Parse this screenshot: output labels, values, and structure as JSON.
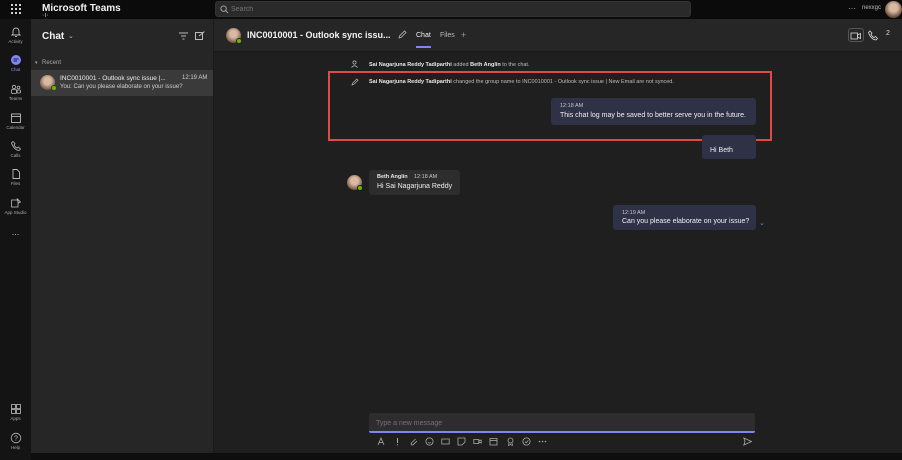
{
  "topbar": {
    "app_title": "Microsoft Teams",
    "search_placeholder": "Search",
    "org_label": "nexxgc"
  },
  "rail": {
    "items": [
      {
        "label": "Activity",
        "icon": "bell-icon"
      },
      {
        "label": "Chat",
        "icon": "chat-icon"
      },
      {
        "label": "Teams",
        "icon": "teams-icon"
      },
      {
        "label": "Calendar",
        "icon": "calendar-icon"
      },
      {
        "label": "Calls",
        "icon": "phone-icon"
      },
      {
        "label": "Files",
        "icon": "file-icon"
      },
      {
        "label": "App Studio",
        "icon": "app-studio-icon"
      },
      {
        "label": "...",
        "icon": "more-icon"
      },
      {
        "label": "Apps",
        "icon": "apps-icon"
      },
      {
        "label": "Help",
        "icon": "help-icon"
      }
    ]
  },
  "sidepanel": {
    "title": "Chat",
    "section": "Recent",
    "chat_item": {
      "title": "INC0010001 - Outlook sync issue |...",
      "time": "12:19 AM",
      "preview": "You: Can you please elaborate on your issue?"
    }
  },
  "header": {
    "title": "INC0010001 - Outlook sync issu...",
    "tabs": [
      {
        "label": "Chat"
      },
      {
        "label": "Files"
      }
    ],
    "add_tab": "+",
    "people_count": "2"
  },
  "messages": {
    "sys1_pre": "Sai Nagarjuna Reddy Tadiparthi",
    "sys1_mid": " added ",
    "sys1_name": "Beth Anglin",
    "sys1_post": " to the chat.",
    "sys2_pre": "Sai Nagarjuna Reddy Tadiparthi",
    "sys2_post": " changed the group name to INC0010001 - Outlook sync issue | New Email are not synced.",
    "m1_time": "12:18 AM",
    "m1_text": "This chat log may be saved to better serve you in the future.",
    "m2_text": "Hi Beth",
    "m3_name": "Beth Anglin",
    "m3_time": "12:18 AM",
    "m3_text": "Hi Sai Nagarjuna Reddy",
    "m4_time": "12:19 AM",
    "m4_text": "Can you please elaborate on your issue?"
  },
  "compose": {
    "placeholder": "Type a new message"
  },
  "colors": {
    "accent": "#7f85f5",
    "highlight": "#e04a45",
    "presence": "#6bb700"
  }
}
